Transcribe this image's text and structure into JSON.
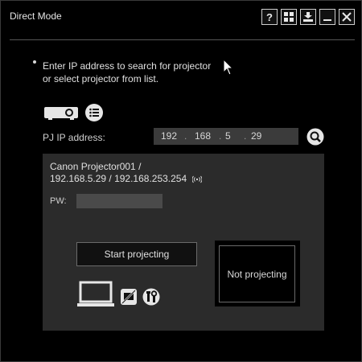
{
  "window": {
    "title": "Direct Mode",
    "buttons": {
      "help": "?",
      "minimize_label": "",
      "close_label": ""
    }
  },
  "instructions": {
    "line1": "Enter IP address to search for projector",
    "line2": "or select projector from list."
  },
  "pj_ip": {
    "label": "PJ IP address:",
    "octets": [
      "192",
      "168",
      "5",
      "29"
    ],
    "separator": "."
  },
  "projector": {
    "name_line1": "Canon Projector001 /",
    "name_line2": "192.168.5.29 / 192.168.253.254",
    "pw_label": "PW:",
    "pw_value": ""
  },
  "actions": {
    "start_label": "Start projecting"
  },
  "status": {
    "text": "Not projecting"
  },
  "colors": {
    "background": "#000000",
    "panel": "#2b2b2b",
    "field": "#3b3b3b",
    "text": "#d8d8d8"
  },
  "icons": [
    "help-icon",
    "layout-icon",
    "download-icon",
    "minimize-icon",
    "close-icon",
    "projector-icon",
    "list-icon",
    "search-icon",
    "wireless-icon",
    "laptop-icon",
    "screen-off-icon",
    "tools-icon"
  ]
}
